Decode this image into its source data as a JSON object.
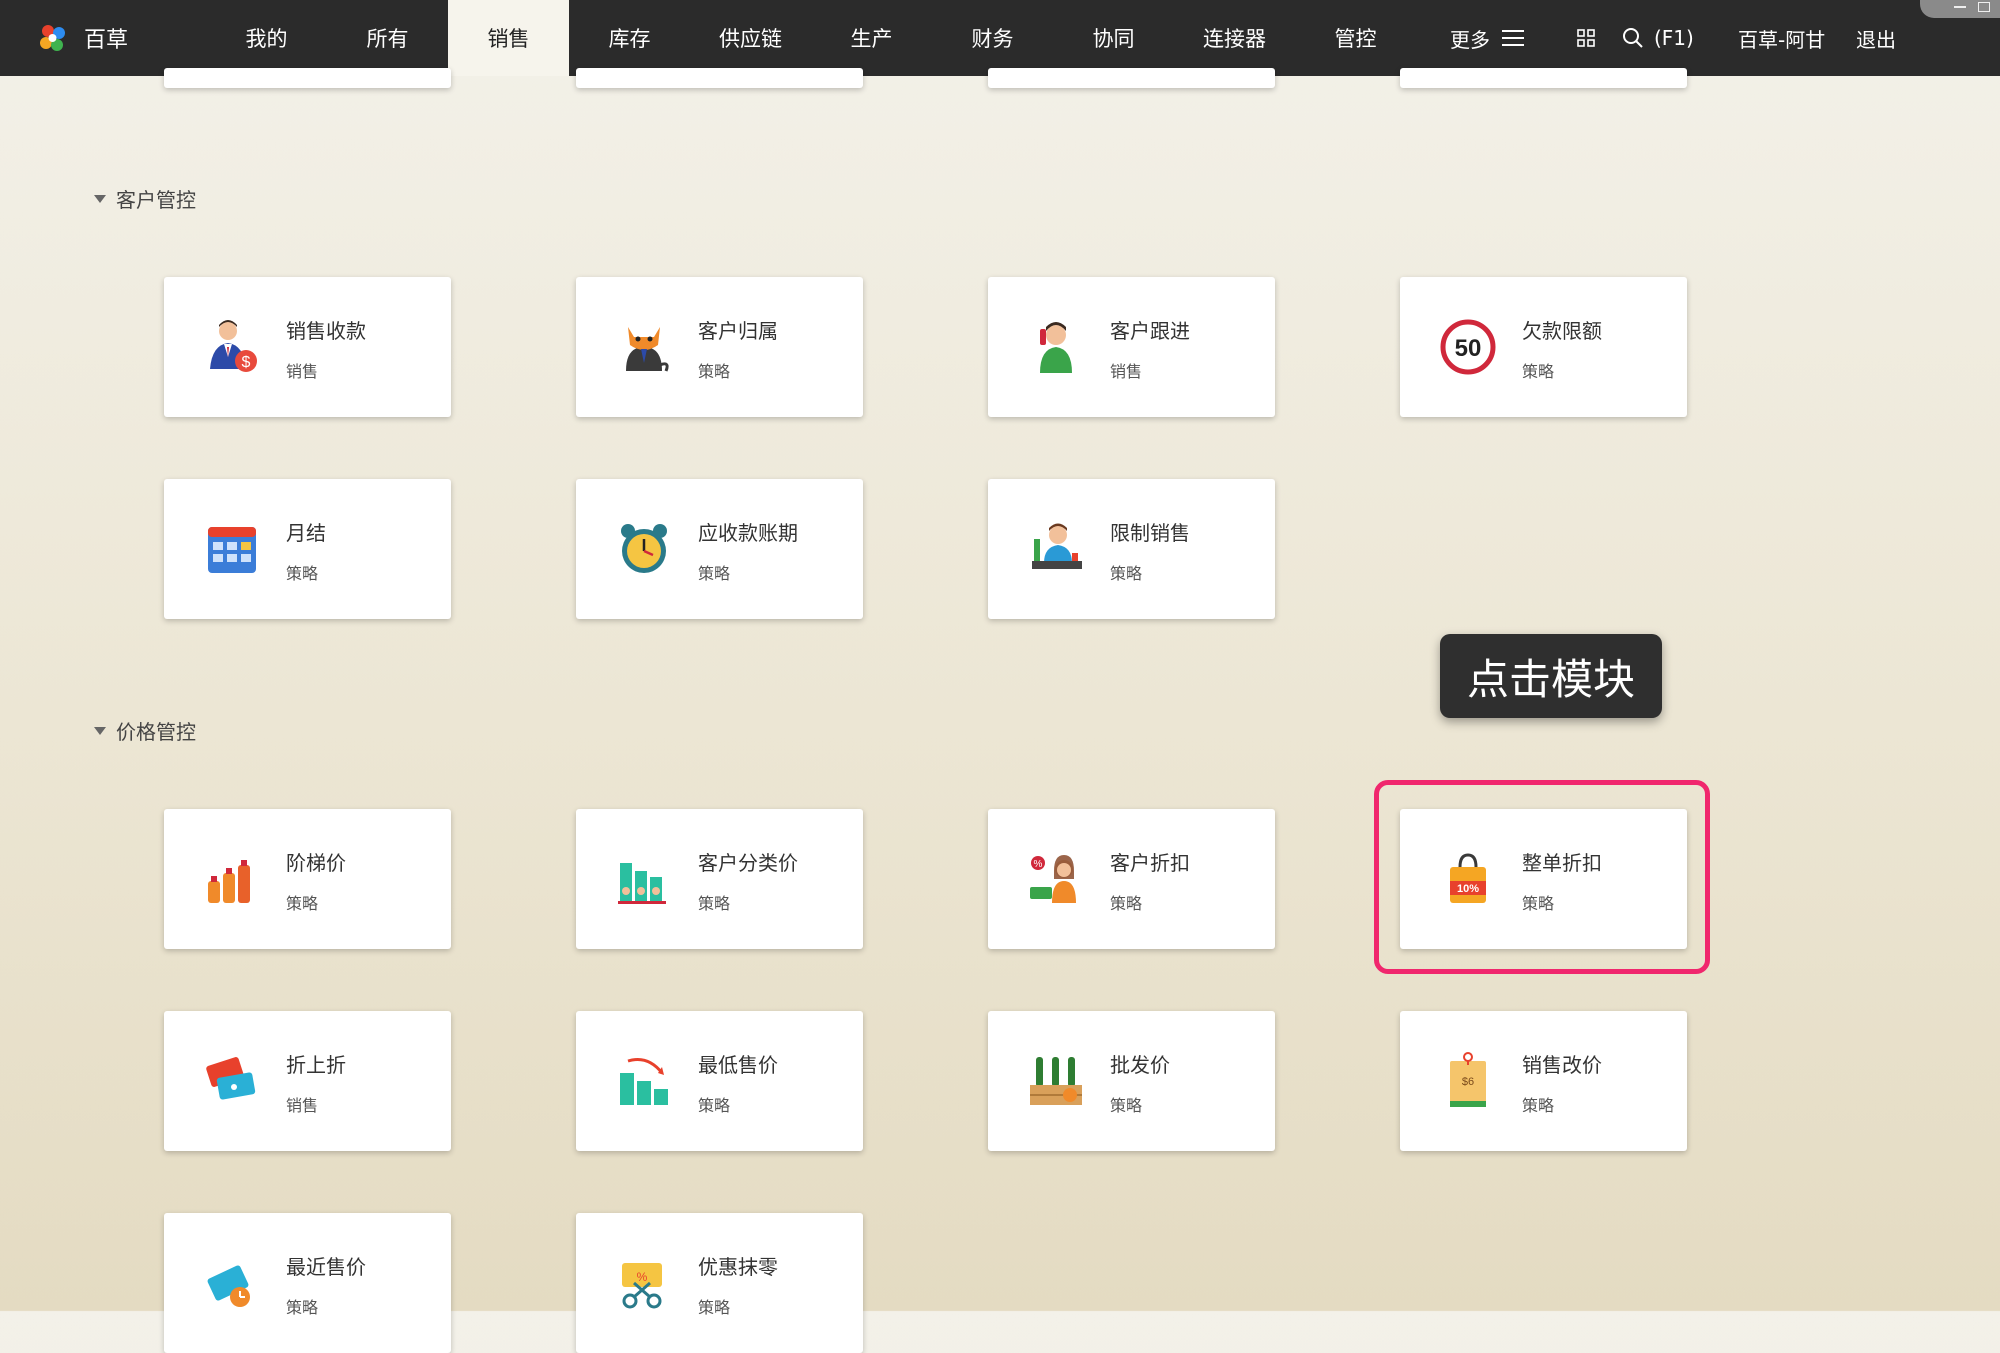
{
  "brand": {
    "name": "百草"
  },
  "nav": [
    {
      "label": "我的"
    },
    {
      "label": "所有"
    },
    {
      "label": "销售",
      "active": true
    },
    {
      "label": "库存"
    },
    {
      "label": "供应链"
    },
    {
      "label": "生产"
    },
    {
      "label": "财务"
    },
    {
      "label": "协同"
    },
    {
      "label": "连接器"
    },
    {
      "label": "管控"
    }
  ],
  "toolbar": {
    "more_label": "更多",
    "search_hint": "(F1)",
    "user_label": "百草-阿甘",
    "logout_label": "退出"
  },
  "sections": [
    {
      "title": "客户管控",
      "cards": [
        {
          "title": "销售收款",
          "sub": "销售",
          "icon": "salesman-dollar-icon"
        },
        {
          "title": "客户归属",
          "sub": "策略",
          "icon": "cat-businessman-icon"
        },
        {
          "title": "客户跟进",
          "sub": "销售",
          "icon": "phone-call-person-icon"
        },
        {
          "title": "欠款限额",
          "sub": "策略",
          "icon": "speed-limit-50-icon",
          "limit_text": "50"
        },
        {
          "title": "月结",
          "sub": "策略",
          "icon": "calendar-icon"
        },
        {
          "title": "应收款账期",
          "sub": "策略",
          "icon": "alarm-clock-icon"
        },
        {
          "title": "限制销售",
          "sub": "策略",
          "icon": "shopkeeper-icon"
        }
      ]
    },
    {
      "title": "价格管控",
      "cards": [
        {
          "title": "阶梯价",
          "sub": "策略",
          "icon": "bottles-ladder-icon"
        },
        {
          "title": "客户分类价",
          "sub": "策略",
          "icon": "grouped-customers-icon"
        },
        {
          "title": "客户折扣",
          "sub": "策略",
          "icon": "woman-discount-icon"
        },
        {
          "title": "整单折扣",
          "sub": "策略",
          "icon": "shopping-bag-10-percent-icon",
          "badge": "10%"
        },
        {
          "title": "折上折",
          "sub": "销售",
          "icon": "coupon-tickets-icon"
        },
        {
          "title": "最低售价",
          "sub": "策略",
          "icon": "money-stacks-down-icon"
        },
        {
          "title": "批发价",
          "sub": "策略",
          "icon": "wine-crate-icon"
        },
        {
          "title": "销售改价",
          "sub": "策略",
          "icon": "price-tag-icon",
          "tag_text": "$6"
        },
        {
          "title": "最近售价",
          "sub": "策略",
          "icon": "tag-clock-icon"
        },
        {
          "title": "优惠抹零",
          "sub": "策略",
          "icon": "scissors-coupon-icon"
        }
      ]
    }
  ],
  "tooltip": {
    "text": "点击模块"
  },
  "colors": {
    "highlight": "#f0276d",
    "topbar": "#2b2b2b",
    "active_tab": "#f6f4ec"
  }
}
